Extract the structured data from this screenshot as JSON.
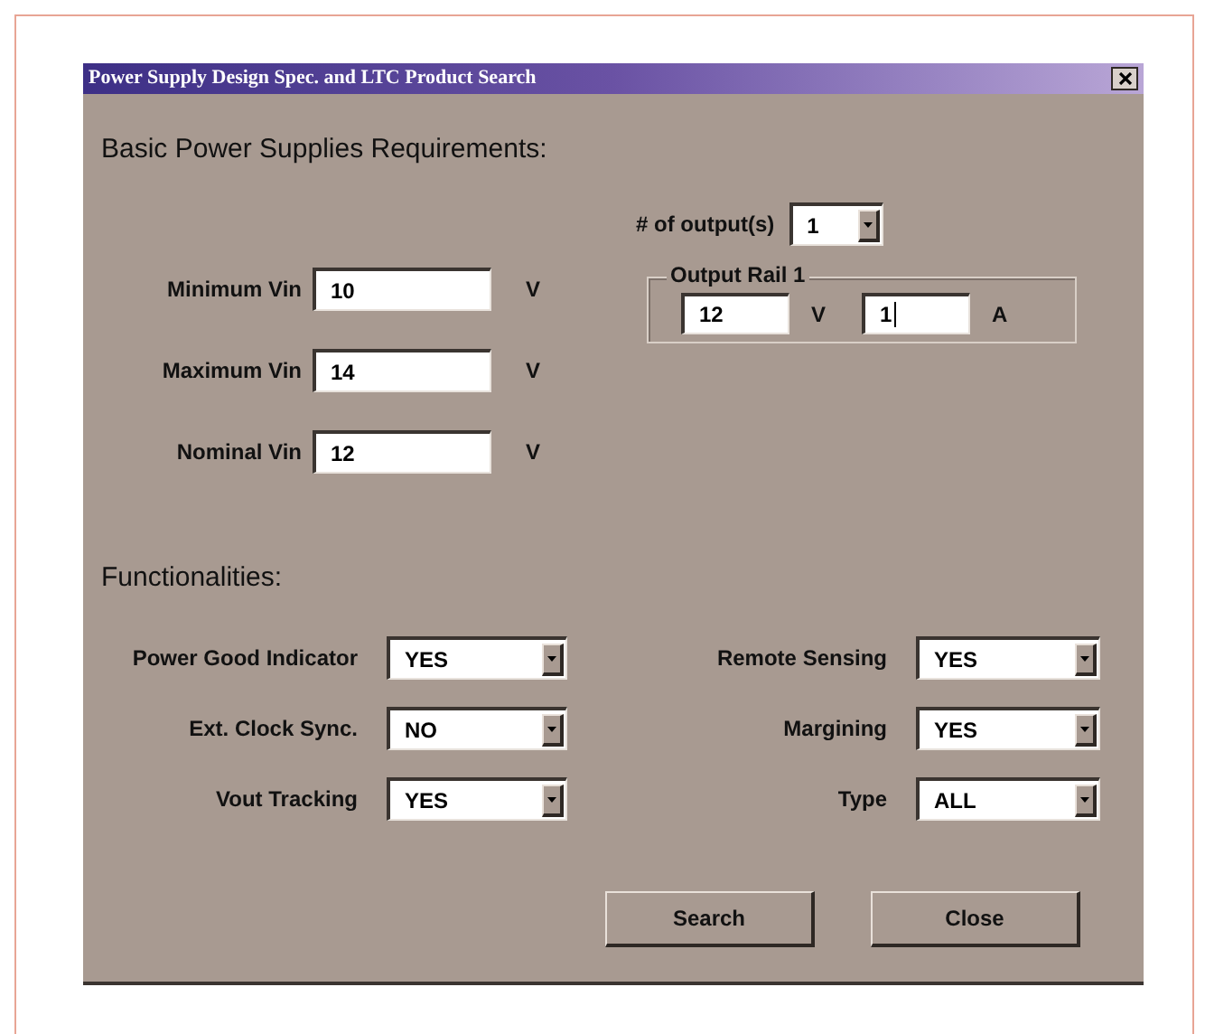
{
  "window": {
    "title": "Power Supply Design Spec. and LTC Product Search"
  },
  "requirements": {
    "heading": "Basic Power Supplies Requirements:",
    "outputs": {
      "label": "# of output(s)",
      "value": "1"
    },
    "inputs": [
      {
        "label": "Minimum Vin",
        "value": "10",
        "unit": "V"
      },
      {
        "label": "Maximum Vin",
        "value": "14",
        "unit": "V"
      },
      {
        "label": "Nominal Vin",
        "value": "12",
        "unit": "V"
      }
    ],
    "output_rail": {
      "title": "Output Rail 1",
      "fields": [
        {
          "value": "12",
          "unit": "V"
        },
        {
          "value": "1",
          "unit": "A",
          "focused": true
        }
      ]
    }
  },
  "functionalities": {
    "heading": "Functionalities:",
    "options": [
      {
        "label": "Power Good Indicator",
        "value": "YES"
      },
      {
        "label": "Remote Sensing",
        "value": "YES"
      },
      {
        "label": "Ext. Clock Sync.",
        "value": "NO"
      },
      {
        "label": "Margining",
        "value": "YES"
      },
      {
        "label": "Vout Tracking",
        "value": "YES"
      },
      {
        "label": "Type",
        "value": "ALL"
      }
    ]
  },
  "buttons": [
    {
      "label": "Search"
    },
    {
      "label": "Close"
    }
  ]
}
